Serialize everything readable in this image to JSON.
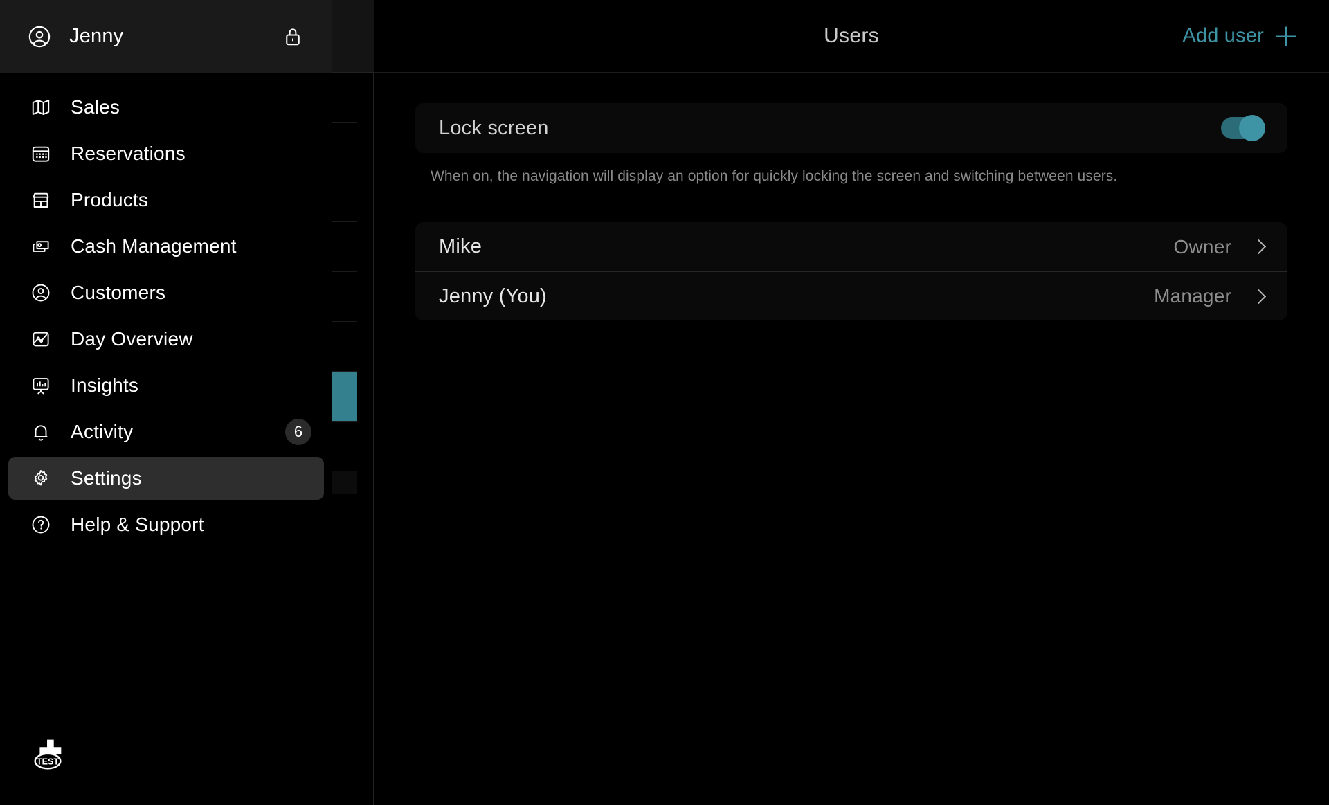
{
  "drawer": {
    "profile": {
      "name": "Jenny",
      "avatar_icon": "user-circle-icon",
      "lock_icon": "lock-icon"
    },
    "items": [
      {
        "label": "Sales",
        "icon": "map-icon"
      },
      {
        "label": "Reservations",
        "icon": "calendar-icon"
      },
      {
        "label": "Products",
        "icon": "storefront-icon"
      },
      {
        "label": "Cash Management",
        "icon": "cash-stack-icon"
      },
      {
        "label": "Customers",
        "icon": "user-circle-icon"
      },
      {
        "label": "Day Overview",
        "icon": "chart-image-icon"
      },
      {
        "label": "Insights",
        "icon": "presentation-chart-icon"
      },
      {
        "label": "Activity",
        "icon": "bell-icon",
        "badge": "6"
      },
      {
        "label": "Settings",
        "icon": "gear-icon",
        "selected": true
      },
      {
        "label": "Help & Support",
        "icon": "question-circle-icon"
      }
    ],
    "brand": {
      "logo_icon": "brand-logo-icon",
      "badge_text": "TEST"
    }
  },
  "header": {
    "title": "Users",
    "add_user_label": "Add user",
    "add_icon": "plus-icon"
  },
  "settings": {
    "lock_screen": {
      "label": "Lock screen",
      "toggle_on": true,
      "helper": "When on, the navigation will display an option for quickly locking the screen and switching between users."
    },
    "users": [
      {
        "name": "Mike",
        "role": "Owner"
      },
      {
        "name": "Jenny (You)",
        "role": "Manager"
      }
    ]
  },
  "colors": {
    "accent": "#3e93a4",
    "toggle_track": "#2c6c78",
    "selected_row": "#2e2e2e",
    "background": "#000000",
    "card": "#0a0a0a"
  }
}
